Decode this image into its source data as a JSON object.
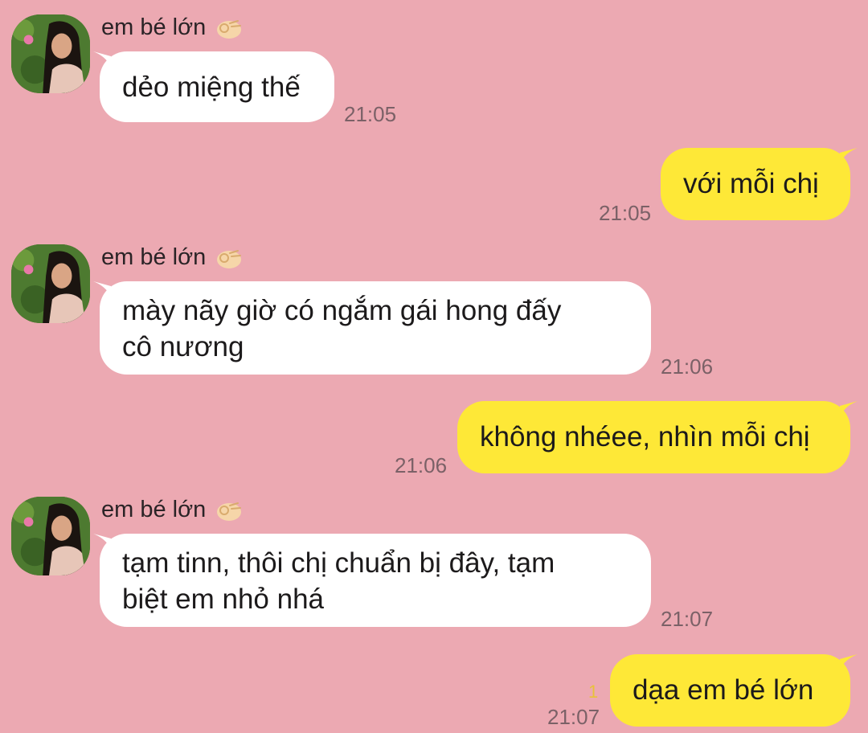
{
  "contact": {
    "name": "em bé lớn"
  },
  "colors": {
    "background": "#ECA9B2",
    "incoming": "#FFFFFF",
    "outgoing": "#FEE837"
  },
  "messages": [
    {
      "direction": "in",
      "text": "dẻo miệng thế",
      "time": "21:05"
    },
    {
      "direction": "out",
      "text": "với mỗi chị",
      "time": "21:05"
    },
    {
      "direction": "in",
      "lines": [
        "mày nãy giờ có ngắm gái hong đấy",
        "cô nương"
      ],
      "time": "21:06"
    },
    {
      "direction": "out",
      "text": "không nhéee, nhìn mỗi chị",
      "time": "21:06"
    },
    {
      "direction": "in",
      "lines": [
        "tạm tinn, thôi chị chuẩn bị đây, tạm",
        "biệt em nhỏ nhá"
      ],
      "time": "21:07"
    },
    {
      "direction": "out",
      "text": "dạa em bé lớn",
      "time": "21:07",
      "unread": "1"
    }
  ]
}
